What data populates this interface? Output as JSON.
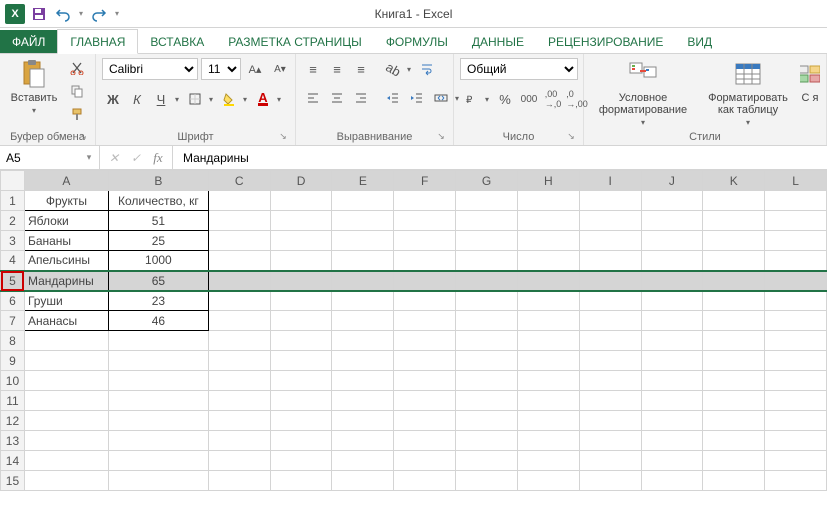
{
  "app": {
    "title": "Книга1 - Excel"
  },
  "tabs": {
    "file": "ФАЙЛ",
    "home": "ГЛАВНАЯ",
    "insert": "ВСТАВКА",
    "pagelayout": "РАЗМЕТКА СТРАНИЦЫ",
    "formulas": "ФОРМУЛЫ",
    "data": "ДАННЫЕ",
    "review": "РЕЦЕНЗИРОВАНИЕ",
    "view": "ВИД"
  },
  "ribbon": {
    "clipboard": {
      "paste": "Вставить",
      "label": "Буфер обмена"
    },
    "font": {
      "name": "Calibri",
      "size": "11",
      "label": "Шрифт",
      "bold": "Ж",
      "italic": "К",
      "underline": "Ч"
    },
    "alignment": {
      "label": "Выравнивание"
    },
    "number": {
      "format": "Общий",
      "label": "Число"
    },
    "styles": {
      "conditional": "Условное форматирование",
      "astable": "Форматировать как таблицу",
      "cellstyles_short": "С я",
      "label": "Стили"
    }
  },
  "formula_bar": {
    "namebox": "A5",
    "formula": "Мандарины"
  },
  "grid": {
    "columns": [
      "A",
      "B",
      "C",
      "D",
      "E",
      "F",
      "G",
      "H",
      "I",
      "J",
      "K",
      "L"
    ],
    "row_count": 15,
    "selected_row": 5,
    "data": {
      "headers": {
        "A": "Фрукты",
        "B": "Количество, кг"
      },
      "rows": [
        {
          "A": "Яблоки",
          "B": "51"
        },
        {
          "A": "Бананы",
          "B": "25"
        },
        {
          "A": "Апельсины",
          "B": "1000"
        },
        {
          "A": "Мандарины",
          "B": "65"
        },
        {
          "A": "Груши",
          "B": "23"
        },
        {
          "A": "Ананасы",
          "B": "46"
        }
      ]
    }
  },
  "chart_data": {
    "type": "table",
    "title": "",
    "columns": [
      "Фрукты",
      "Количество, кг"
    ],
    "rows": [
      [
        "Яблоки",
        51
      ],
      [
        "Бананы",
        25
      ],
      [
        "Апельсины",
        1000
      ],
      [
        "Мандарины",
        65
      ],
      [
        "Груши",
        23
      ],
      [
        "Ананасы",
        46
      ]
    ]
  }
}
